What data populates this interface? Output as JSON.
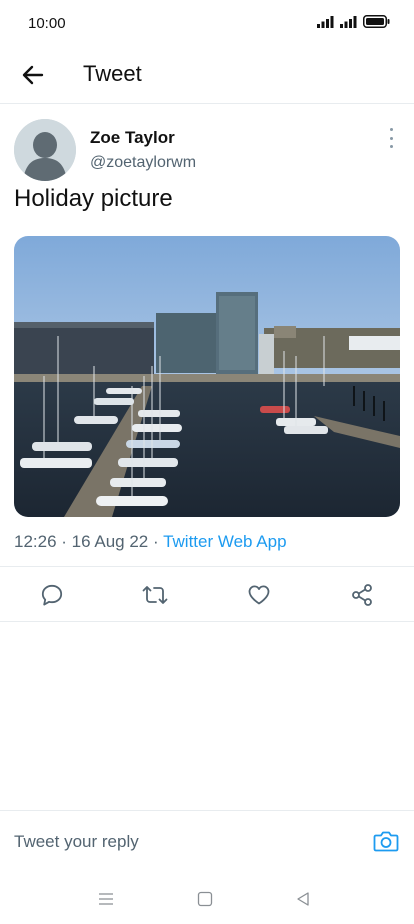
{
  "status_bar": {
    "time": "10:00"
  },
  "header": {
    "title": "Tweet",
    "back_icon": "arrow-left-icon"
  },
  "tweet": {
    "author_name": "Zoe Taylor",
    "author_handle": "@zoetaylorwm",
    "text": "Holiday picture",
    "time": "12:26",
    "date": "16 Aug 22",
    "source": "Twitter Web App",
    "image_alt_subject": "harbour-marina-photo"
  },
  "actions": {
    "reply_icon": "reply-icon",
    "retweet_icon": "retweet-icon",
    "like_icon": "heart-icon",
    "share_icon": "share-icon"
  },
  "reply_bar": {
    "placeholder": "Tweet your reply",
    "camera_icon": "camera-icon"
  },
  "colors": {
    "accent": "#1d9bf0",
    "secondary_text": "#536471",
    "divider": "#e8ecef"
  }
}
